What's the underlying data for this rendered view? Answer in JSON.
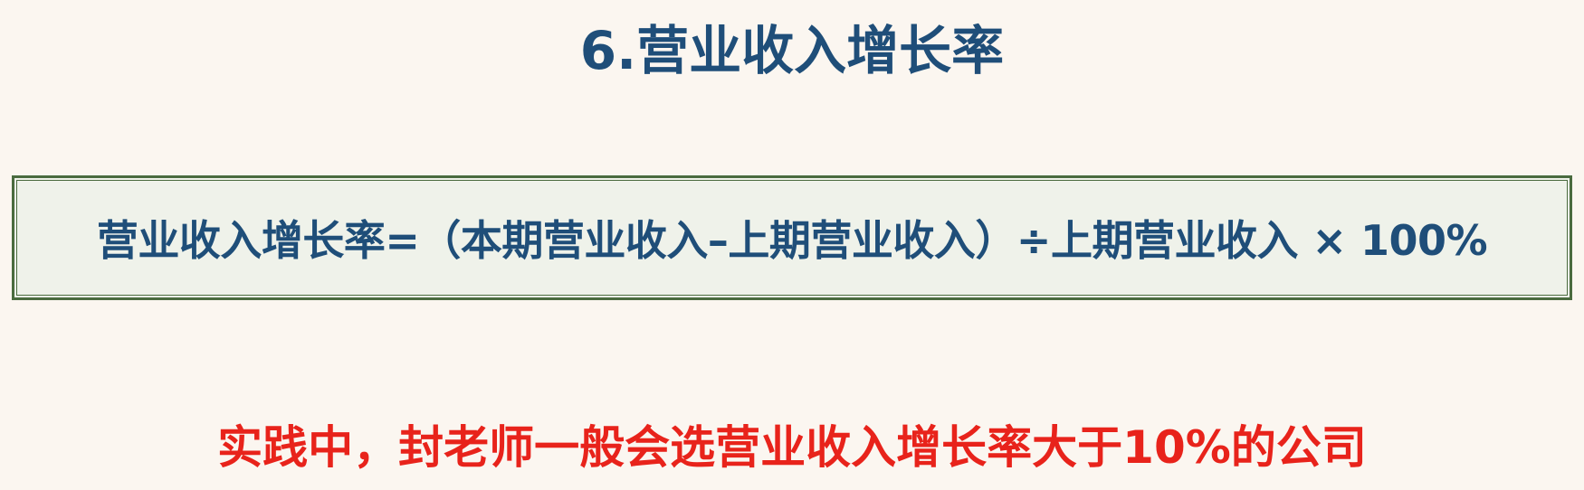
{
  "slide": {
    "title": "6.营业收入增长率",
    "formula": "营业收入增长率=（本期营业收入–上期营业收入）÷上期营业收入 × 100%",
    "note": "实践中，封老师一般会选营业收入增长率大于10%的公司"
  },
  "colors": {
    "background": "#FBF6F0",
    "title": "#1F4E79",
    "formula_text": "#1F4E79",
    "formula_box_bg": "#EFF2EA",
    "formula_box_border": "#4A6B3F",
    "note": "#E8231B"
  }
}
